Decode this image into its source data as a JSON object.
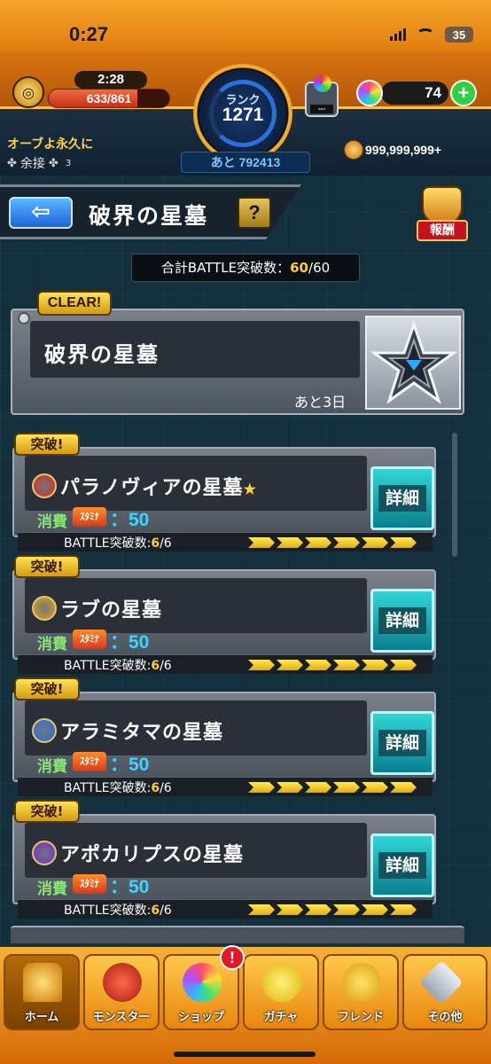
{
  "status_bar": {
    "time": "0:27",
    "battery": "35"
  },
  "header": {
    "stamina_timer": "2:28",
    "stamina": "633/861",
    "stamina_fraction": 0.735,
    "rank_label": "ランク",
    "rank": "1271",
    "next_rank": "あと 792413",
    "gacha_box_label": "---",
    "orb_count": "74",
    "orb_add_label": "+",
    "guild_name": "オーブよ永久に",
    "assist_label": "余接",
    "assist_count": "3",
    "coins": "999,999,999+"
  },
  "page": {
    "back_label": "⇦",
    "title": "破界の星墓",
    "help_label": "?",
    "reward_label": "報酬",
    "total_battle_label": "合計BATTLE突破数：",
    "total_battle_done": "60",
    "total_battle_sep": "/",
    "total_battle_max": "60"
  },
  "summary": {
    "clear_label": "CLEAR!",
    "name": "破界の星墓",
    "days_left": "あと3日"
  },
  "quests": [
    {
      "badge": "突破!",
      "name": "パラノヴィアの星墓",
      "star": "★",
      "element": "fire",
      "element_color": "#d8301e",
      "cost_label": "消費",
      "stamina_tag": "ｽﾀﾐﾅ",
      "cost": "：50",
      "battle_label": "BATTLE突破数:",
      "battle_done": "6",
      "battle_sep": "/",
      "battle_max": "6",
      "detail_label": "詳細"
    },
    {
      "badge": "突破!",
      "name": "ラブの星墓",
      "star": "",
      "element": "light",
      "element_color": "#d8a417",
      "cost_label": "消費",
      "stamina_tag": "ｽﾀﾐﾅ",
      "cost": "：50",
      "battle_label": "BATTLE突破数:",
      "battle_done": "6",
      "battle_sep": "/",
      "battle_max": "6",
      "detail_label": "詳細"
    },
    {
      "badge": "突破!",
      "name": "アラミタマの星墓",
      "star": "",
      "element": "water",
      "element_color": "#1e73e8",
      "cost_label": "消費",
      "stamina_tag": "ｽﾀﾐﾅ",
      "cost": "：50",
      "battle_label": "BATTLE突破数:",
      "battle_done": "6",
      "battle_sep": "/",
      "battle_max": "6",
      "detail_label": "詳細"
    },
    {
      "badge": "突破!",
      "name": "アポカリプスの星墓",
      "star": "",
      "element": "dark",
      "element_color": "#7a2ad0",
      "cost_label": "消費",
      "stamina_tag": "ｽﾀﾐﾅ",
      "cost": "：50",
      "battle_label": "BATTLE突破数:",
      "battle_done": "6",
      "battle_sep": "/",
      "battle_max": "6",
      "detail_label": "詳細"
    }
  ],
  "bottom_nav": {
    "items": [
      {
        "label": "ホーム",
        "icon": "home-icon"
      },
      {
        "label": "モンスター",
        "icon": "monster-icon"
      },
      {
        "label": "ショップ",
        "icon": "shop-orb-icon"
      },
      {
        "label": "ガチャ",
        "icon": "gacha-icon"
      },
      {
        "label": "フレンド",
        "icon": "friend-icon"
      },
      {
        "label": "その他",
        "icon": "other-icon"
      }
    ],
    "shop_notification": "!"
  }
}
